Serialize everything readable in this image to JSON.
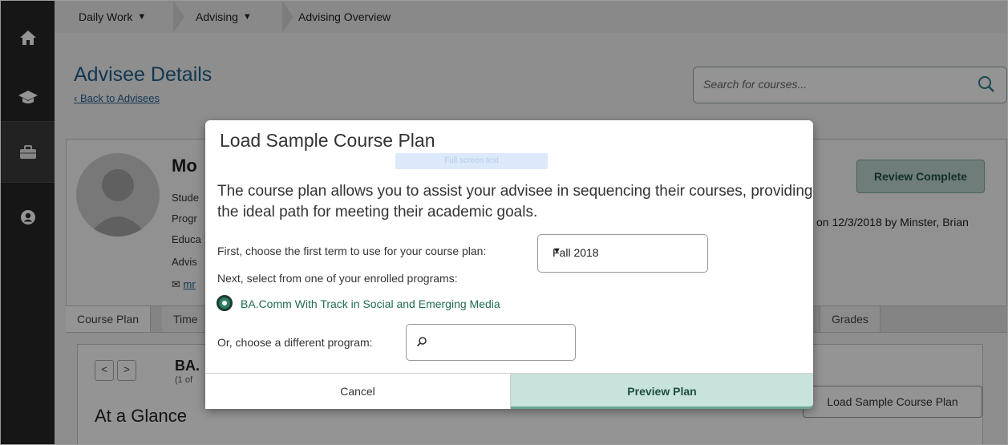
{
  "breadcrumb": {
    "item1": "Daily Work",
    "item2": "Advising",
    "item3": "Advising Overview",
    "caret": "⌄"
  },
  "page": {
    "title": "Advisee Details",
    "back_link": "Back to Advisees"
  },
  "search": {
    "placeholder": "Search for courses..."
  },
  "profile": {
    "name_partial": "Mo",
    "lines": [
      "Stude",
      "Progr",
      "Educa",
      "Advis"
    ],
    "email_partial": "mr",
    "reviewed_text": "on 12/3/2018 by Minster, Brian",
    "review_button": "Review Complete"
  },
  "tabs": {
    "course_plan": "Course Plan",
    "time": "Time",
    "grades": "Grades"
  },
  "plan_panel": {
    "prev": "<",
    "next": ">",
    "program_partial": "BA.",
    "of_partial": "(1 of",
    "at_a_glance": "At a Glance",
    "load_button": "Load Sample Course Plan"
  },
  "modal": {
    "title": "Load Sample Course Plan",
    "ghost_text": "Full screen text",
    "description": "The course plan allows you to assist your advisee in sequencing their courses, providing the ideal path for meeting their academic goals.",
    "first_term_label": "First, choose the first term to use for your course plan:",
    "first_term_value": "Fall 2018",
    "enrolled_label": "Next, select from one of your enrolled programs:",
    "program_option": "BA.Comm With Track in Social and Emerging Media",
    "different_label": "Or, choose a different program:",
    "different_value": "",
    "cancel": "Cancel",
    "preview": "Preview Plan"
  }
}
